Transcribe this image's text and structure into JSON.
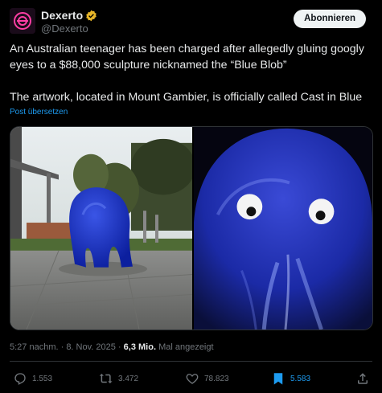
{
  "author": {
    "display_name": "Dexerto",
    "handle": "@Dexerto",
    "avatar_icon": "dexerto-logo-icon",
    "verified_badge_color": "#e8b629"
  },
  "follow_button": {
    "label": "Abonnieren"
  },
  "tweet": {
    "paragraph_1": "An Australian teenager has been charged after allegedly gluing googly eyes to a $88,000 sculpture nicknamed the “Blue Blob”",
    "paragraph_2": "The artwork, located in Mount Gambier, is officially called Cast in Blue"
  },
  "translate_link": "Post übersetzen",
  "meta": {
    "timestamp": "5:27 nachm. · 8. Nov. 2025 ·",
    "views_count": "6,3 Mio.",
    "views_label": "Mal angezeigt"
  },
  "actions": {
    "replies": "1.553",
    "reposts": "3.472",
    "likes": "78.823",
    "bookmarks": "5.583"
  },
  "colors": {
    "accent": "#1d9bf0",
    "background": "#000000",
    "text": "#e7e9ea",
    "muted": "#71767b"
  }
}
